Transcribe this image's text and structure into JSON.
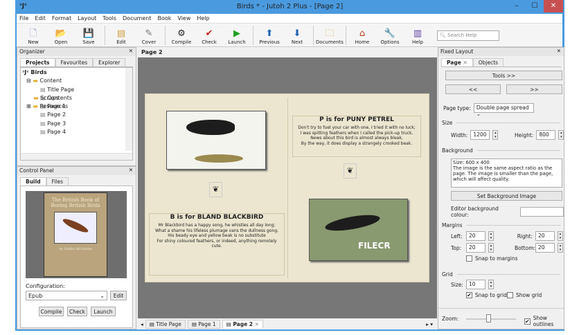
{
  "window": {
    "title": "Birds * - Jutoh 2 Plus - [Page 2]",
    "logo": "ᵓJᶜ",
    "minimize": "–",
    "maximize": "☐",
    "close": "✕"
  },
  "menu": [
    "File",
    "Edit",
    "Format",
    "Layout",
    "Tools",
    "Document",
    "Book",
    "View",
    "Help"
  ],
  "toolbar": [
    {
      "label": "New",
      "icon": "🗋",
      "color": "#8899cc"
    },
    {
      "label": "Open",
      "icon": "📂",
      "color": "#e8b020"
    },
    {
      "label": "Save",
      "icon": "💾",
      "color": "#5060a0"
    },
    {
      "label": "Edit",
      "icon": "▤",
      "color": "#d0a040"
    },
    {
      "label": "Cover",
      "icon": "✎",
      "color": "#777"
    },
    {
      "label": "Compile",
      "icon": "⚙",
      "color": "#222"
    },
    {
      "label": "Check",
      "icon": "✔",
      "color": "#cc2020"
    },
    {
      "label": "Launch",
      "icon": "▶",
      "color": "#20a020"
    },
    {
      "label": "Previous",
      "icon": "⬆",
      "color": "#2060b0"
    },
    {
      "label": "Next",
      "icon": "⬇",
      "color": "#2060b0"
    },
    {
      "label": "Documents",
      "icon": "🗀",
      "color": "#d8b040"
    },
    {
      "label": "Home",
      "icon": "⌂",
      "color": "#c04020"
    },
    {
      "label": "Options",
      "icon": "🔧",
      "color": "#c0a020"
    },
    {
      "label": "Help",
      "icon": "▥",
      "color": "#6040a0"
    }
  ],
  "search": {
    "placeholder": "Search Help",
    "icon": "search-icon"
  },
  "organizer": {
    "title": "Organizer",
    "tabs": [
      "Projects",
      "Favourites",
      "Explorer"
    ],
    "tree": {
      "root": "Birds",
      "content": "Content",
      "pages": [
        "Title Page",
        "Contents",
        "Page 1",
        "Page 2",
        "Page 3",
        "Page 4"
      ],
      "folders": [
        "Scraps",
        "Resources"
      ]
    }
  },
  "control_panel": {
    "title": "Control Panel",
    "tabs": [
      "Build",
      "Files"
    ],
    "cover": {
      "title": "The British Book of Boring British Birds",
      "author": "by Robin McLeobe"
    },
    "configuration_label": "Configuration:",
    "configuration_value": "Epub",
    "edit": "Edit",
    "buttons": [
      "Compile",
      "Check",
      "Launch"
    ]
  },
  "editor": {
    "header": "Page 2",
    "right_text": {
      "title": "P is for PUNY PETREL",
      "lines": [
        "Don't try to fuel your car with one, I tried it with no luck;",
        "I was spitting feathers when I called the pick-up truck.",
        "News about this bird is almost always bleak,",
        "By the way, it does display a strangely crooked beak."
      ]
    },
    "left_text": {
      "title": "B is for BLAND BLACKBIRD",
      "lines": [
        "Mr Blackbird has a happy song, he whistles all day long;",
        "What a shame his lifeless plumage vans the dullness gong.",
        "His beady eye and yellow beak is no substitute",
        "For shiny coloured feathers, or indeed, anything remotely cute."
      ]
    },
    "watermark": "FILECR",
    "tabs": [
      "Title Page",
      "Page 1",
      "Page 2"
    ],
    "active_tab": "Page 2"
  },
  "fixed_layout": {
    "title": "Fixed Layout",
    "tabs": [
      "Page",
      "Objects"
    ],
    "tools": "Tools >>",
    "prev": "<<",
    "next": ">>",
    "page_type_label": "Page type:",
    "page_type": "Double page spread",
    "size_label": "Size",
    "width_label": "Width:",
    "width": "1200",
    "height_label": "Height:",
    "height": "800",
    "background_label": "Background",
    "background_info": "Size: 600 x 400\nThe image is the same aspect ratio as the page. The image is smaller than the page, which will affect quality.",
    "set_bg": "Set Background Image",
    "editor_bg_label": "Editor background colour:",
    "margins_label": "Margins",
    "left_label": "Left:",
    "left": "20",
    "right_label": "Right:",
    "right": "20",
    "top_label": "Top:",
    "top": "20",
    "bottom_label": "Bottom:",
    "bottom": "20",
    "snap_margins": "Snap to margins",
    "snap_margins_checked": false,
    "grid_label": "Grid",
    "grid_size_label": "Size:",
    "grid_size": "10",
    "snap_grid": "Snap to grid",
    "snap_grid_checked": true,
    "show_grid": "Show grid",
    "show_grid_checked": false,
    "zoom_label": "Zoom:",
    "zoom_level": 0.45,
    "show_outlines": "Show outlines",
    "show_outlines_checked": true
  }
}
